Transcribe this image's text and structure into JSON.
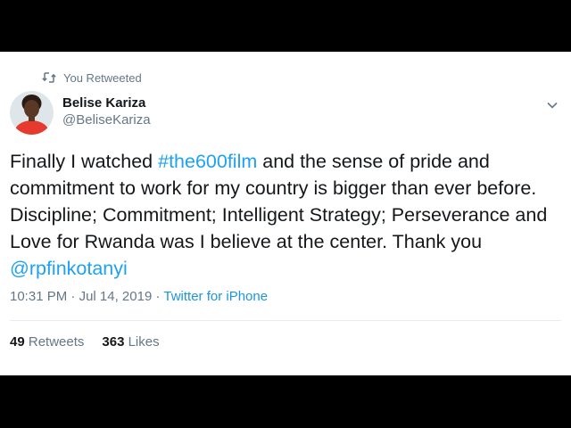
{
  "retweet": {
    "label": "You Retweeted",
    "icon": "retweet-icon"
  },
  "author": {
    "name": "Belise Kariza",
    "handle": "@BeliseKariza",
    "avatar_icon": "user-avatar"
  },
  "tweet": {
    "p1": "Finally I watched ",
    "hashtag": "#the600film",
    "p2": " and the sense of pride and commitment to work for my country is bigger than ever before. Discipline; Commitment;  Intelligent Strategy; Perseverance and Love for Rwanda was I believe at the center. Thank you ",
    "mention": "@rpfinkotanyi"
  },
  "meta": {
    "time": "10:31 PM",
    "sep": " · ",
    "date": "Jul 14, 2019",
    "source": "Twitter for iPhone"
  },
  "stats": {
    "retweets_count": "49",
    "retweets_label": "Retweets",
    "likes_count": "363",
    "likes_label": "Likes"
  },
  "colors": {
    "link": "#1da1f2",
    "muted": "#657786",
    "text": "#14171a"
  }
}
